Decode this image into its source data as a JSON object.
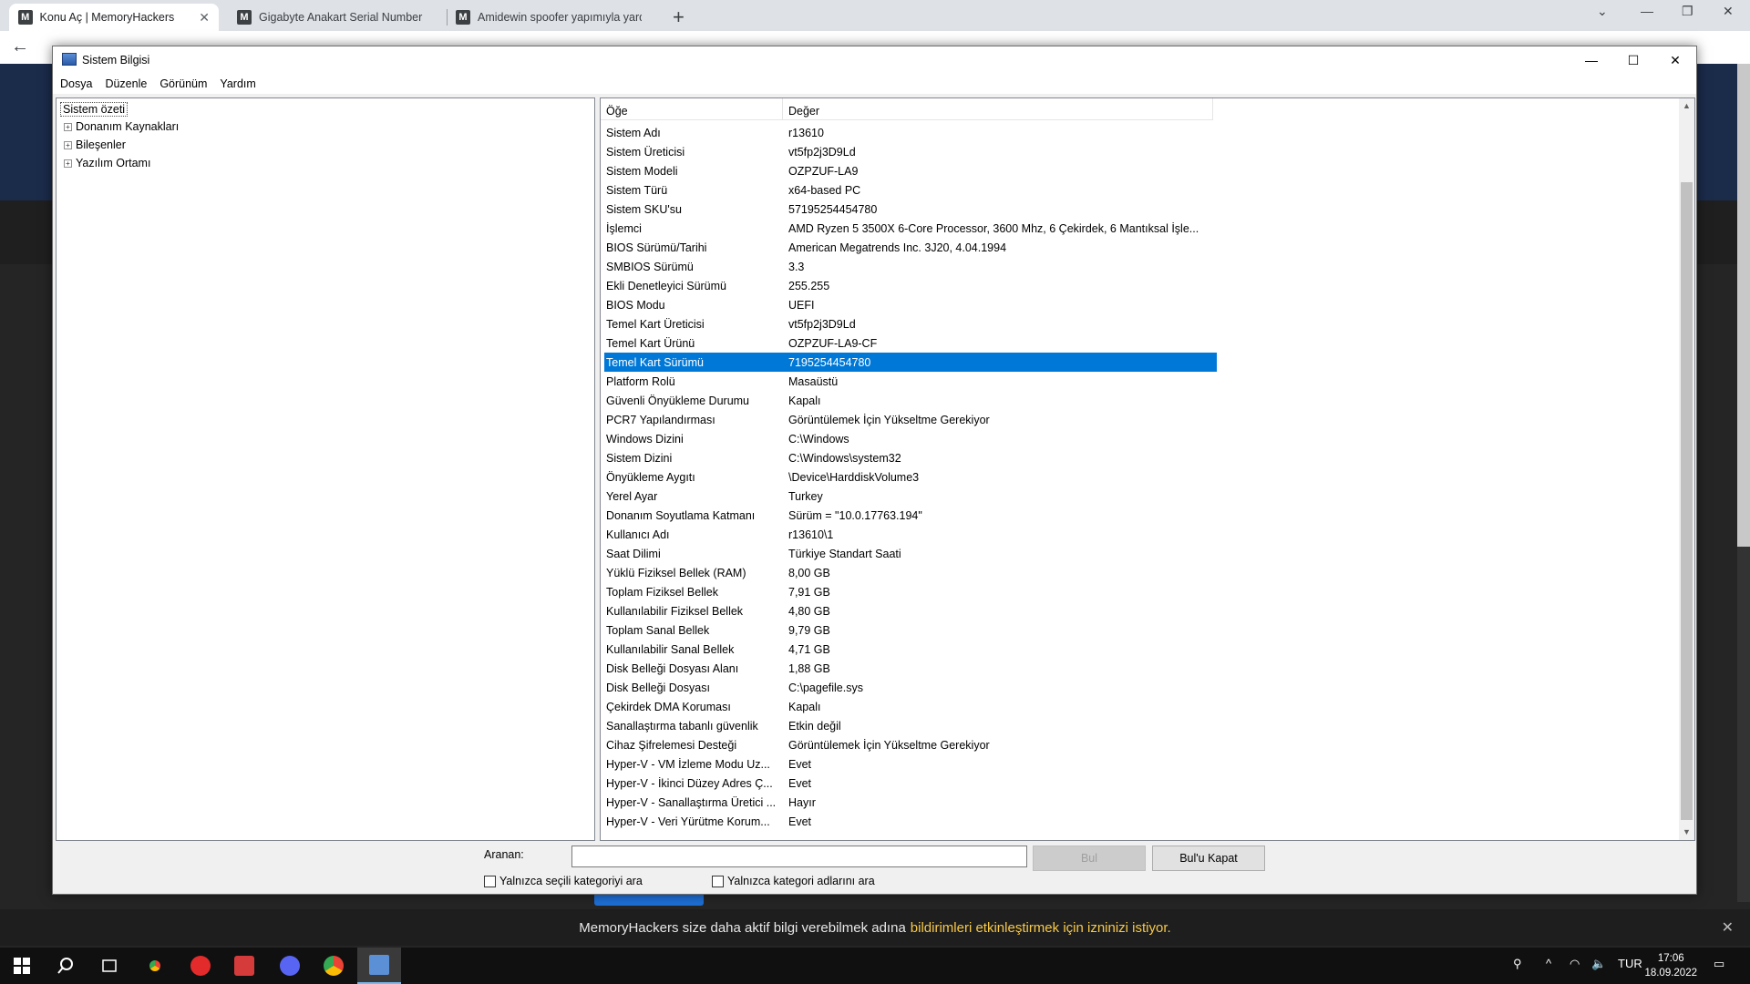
{
  "browser": {
    "tabs": [
      {
        "title": "Konu Aç | MemoryHackers",
        "favicon": "M"
      },
      {
        "title": "Gigabyte Anakart Serial Number",
        "favicon": "M"
      },
      {
        "title": "Amidewin spoofer yapımıyla yard",
        "favicon": "M"
      }
    ],
    "url": "memoryhackers.org/forums/valorant-hile-hack.624/post-thread"
  },
  "notification": {
    "text": "MemoryHackers size daha aktif bilgi verebilmek adına",
    "link": "bildirimleri etkinleştirmek için izninizi istiyor."
  },
  "window": {
    "title": "Sistem Bilgisi",
    "menu": [
      "Dosya",
      "Düzenle",
      "Görünüm",
      "Yardım"
    ]
  },
  "tree": {
    "root": "Sistem özeti",
    "children": [
      "Donanım Kaynakları",
      "Bileşenler",
      "Yazılım Ortamı"
    ]
  },
  "list": {
    "headers": {
      "item": "Öğe",
      "value": "Değer"
    },
    "selected_index": 12,
    "rows": [
      {
        "item": "Sistem Adı",
        "value": "r13610"
      },
      {
        "item": "Sistem Üreticisi",
        "value": "vt5fp2j3D9Ld"
      },
      {
        "item": "Sistem Modeli",
        "value": "OZPZUF-LA9"
      },
      {
        "item": "Sistem Türü",
        "value": "x64-based PC"
      },
      {
        "item": "Sistem SKU'su",
        "value": "57195254454780"
      },
      {
        "item": "İşlemci",
        "value": "AMD Ryzen 5 3500X 6-Core Processor, 3600 Mhz, 6 Çekirdek, 6 Mantıksal İşle..."
      },
      {
        "item": "BIOS Sürümü/Tarihi",
        "value": "American Megatrends Inc. 3J20, 4.04.1994"
      },
      {
        "item": "SMBIOS Sürümü",
        "value": "3.3"
      },
      {
        "item": "Ekli Denetleyici Sürümü",
        "value": "255.255"
      },
      {
        "item": "BIOS Modu",
        "value": "UEFI"
      },
      {
        "item": "Temel Kart Üreticisi",
        "value": "vt5fp2j3D9Ld"
      },
      {
        "item": "Temel Kart Ürünü",
        "value": "OZPZUF-LA9-CF"
      },
      {
        "item": "Temel Kart Sürümü",
        "value": "7195254454780"
      },
      {
        "item": "Platform Rolü",
        "value": "Masaüstü"
      },
      {
        "item": "Güvenli Önyükleme Durumu",
        "value": "Kapalı"
      },
      {
        "item": "PCR7 Yapılandırması",
        "value": "Görüntülemek İçin Yükseltme Gerekiyor"
      },
      {
        "item": "Windows Dizini",
        "value": "C:\\Windows"
      },
      {
        "item": "Sistem Dizini",
        "value": "C:\\Windows\\system32"
      },
      {
        "item": "Önyükleme Aygıtı",
        "value": "\\Device\\HarddiskVolume3"
      },
      {
        "item": "Yerel Ayar",
        "value": "Turkey"
      },
      {
        "item": "Donanım Soyutlama Katmanı",
        "value": "Sürüm = \"10.0.17763.194\""
      },
      {
        "item": "Kullanıcı Adı",
        "value": "r13610\\1"
      },
      {
        "item": "Saat Dilimi",
        "value": "Türkiye Standart Saati"
      },
      {
        "item": "Yüklü Fiziksel Bellek (RAM)",
        "value": "8,00 GB"
      },
      {
        "item": "Toplam Fiziksel Bellek",
        "value": "7,91 GB"
      },
      {
        "item": "Kullanılabilir Fiziksel Bellek",
        "value": "4,80 GB"
      },
      {
        "item": "Toplam Sanal Bellek",
        "value": "9,79 GB"
      },
      {
        "item": "Kullanılabilir Sanal Bellek",
        "value": "4,71 GB"
      },
      {
        "item": "Disk Belleği Dosyası Alanı",
        "value": "1,88 GB"
      },
      {
        "item": "Disk Belleği Dosyası",
        "value": "C:\\pagefile.sys"
      },
      {
        "item": "Çekirdek DMA Koruması",
        "value": "Kapalı"
      },
      {
        "item": "Sanallaştırma tabanlı güvenlik",
        "value": "Etkin değil"
      },
      {
        "item": "Cihaz Şifrelemesi Desteği",
        "value": "Görüntülemek İçin Yükseltme Gerekiyor"
      },
      {
        "item": "Hyper-V - VM İzleme Modu Uz...",
        "value": "Evet"
      },
      {
        "item": "Hyper-V - İkinci Düzey Adres Ç...",
        "value": "Evet"
      },
      {
        "item": "Hyper-V - Sanallaştırma Üretici ...",
        "value": "Hayır"
      },
      {
        "item": "Hyper-V - Veri Yürütme Korum...",
        "value": "Evet"
      }
    ]
  },
  "find": {
    "label": "Aranan:",
    "value": "",
    "find_button": "Bul",
    "close_button": "Bul'u Kapat",
    "only_selected_category": "Yalnızca seçili kategoriyi ara",
    "only_category_names": "Yalnızca kategori adlarını ara"
  },
  "taskbar": {
    "language": "TUR",
    "time": "17:06",
    "date": "18.09.2022"
  },
  "colors": {
    "selection": "#0078d7",
    "notification_link": "#f7c948"
  }
}
